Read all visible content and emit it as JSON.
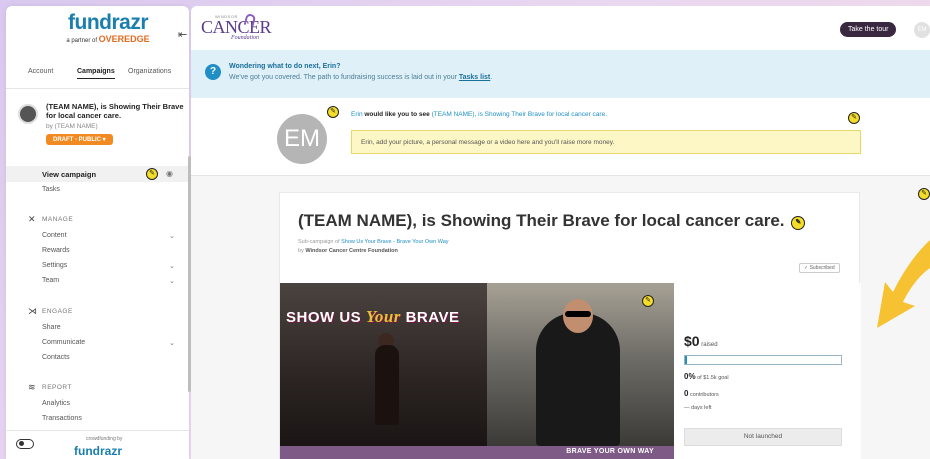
{
  "colors": {
    "brand_blue": "#1a7fae",
    "draft_orange": "#f28a22",
    "edit_yellow": "#f3dc2a",
    "progress_blue": "#1f8fc6",
    "arrow_yellow": "#f6c232"
  },
  "sidebar": {
    "logo_word": "fundrazr",
    "logo_sub": "a partner of",
    "logo_partner": "OVEREDGE",
    "collapse_icon": "⇤",
    "tabs": [
      "Account",
      "Campaigns",
      "Organizations"
    ],
    "campaign": {
      "title": "(TEAM NAME), is Showing Their Brave for local cancer care.",
      "by": "by (TEAM NAME)",
      "badge": "DRAFT - PUBLIC ▾"
    },
    "view_campaign": "View campaign",
    "tasks": "Tasks",
    "sections": {
      "manage": {
        "label": "MANAGE",
        "items": [
          "Content",
          "Rewards",
          "Settings",
          "Team"
        ]
      },
      "engage": {
        "label": "ENGAGE",
        "items": [
          "Share",
          "Communicate",
          "Contacts"
        ]
      },
      "report": {
        "label": "REPORT",
        "items": [
          "Analytics",
          "Transactions"
        ]
      }
    },
    "footer_sub": "crowdfunding by",
    "footer_logo": "fundrazr"
  },
  "topbar": {
    "logo_small": "WINDSOR",
    "logo_big": "CANCER",
    "logo_found": "Foundation",
    "tour_button": "Take the tour",
    "avatar_initials": "EM"
  },
  "banner": {
    "line1": "Wondering what to do next, Erin?",
    "line2_prefix": "We've got you covered. The path to fundraising success is laid out in your ",
    "line2_link": "Tasks list",
    "line2_suffix": "."
  },
  "message": {
    "avatar_initials": "EM",
    "sender": "Erin",
    "line_mid": " would like you to see ",
    "line_link": "(TEAM NAME), is Showing Their Brave for local cancer care.",
    "box_text": "Erin, add your picture, a personal message or a video here and you'll raise more money."
  },
  "campaign": {
    "title": "(TEAM NAME), is Showing Their Brave for local cancer care.",
    "sub_prefix": "Sub-campaign of ",
    "sub_link": "Show Us Your Brave - Brave Your Own Way",
    "by_prefix": "by ",
    "by_org": "Windsor Cancer Centre Foundation",
    "subscribed": "✓ Subscribed",
    "media_text_1": "SHOW US ",
    "media_text_2": "Your",
    "media_text_3": " BRAVE",
    "media_strip": "BRAVE YOUR OWN WAY",
    "raised_amount": "$0",
    "raised_label": " raised",
    "progress_fraction": 0.01,
    "pct": "0%",
    "goal_label": " of $1.5k goal",
    "contributors": "0",
    "contributors_label": " contributors",
    "days_left": "— days left",
    "status_button": "Not launched"
  }
}
